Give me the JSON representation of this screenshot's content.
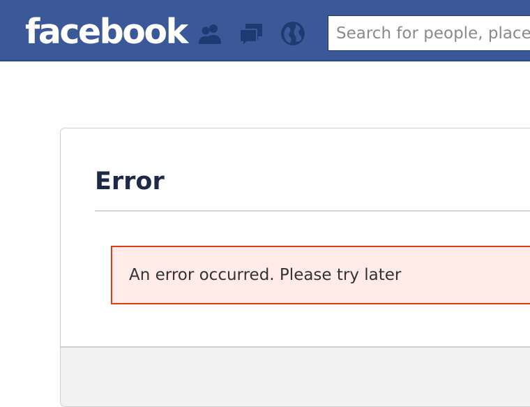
{
  "header": {
    "logo_text": "facebook",
    "search_placeholder": "Search for people, places and things",
    "icons": [
      "friend-requests-icon",
      "messages-icon",
      "notifications-icon"
    ]
  },
  "dialog": {
    "title": "Error",
    "message": "An error occurred. Please try later"
  },
  "colors": {
    "brand_blue": "#3b5998",
    "error_border": "#dd3c10",
    "error_background": "#ffebe8",
    "title_color": "#1c2a47"
  }
}
